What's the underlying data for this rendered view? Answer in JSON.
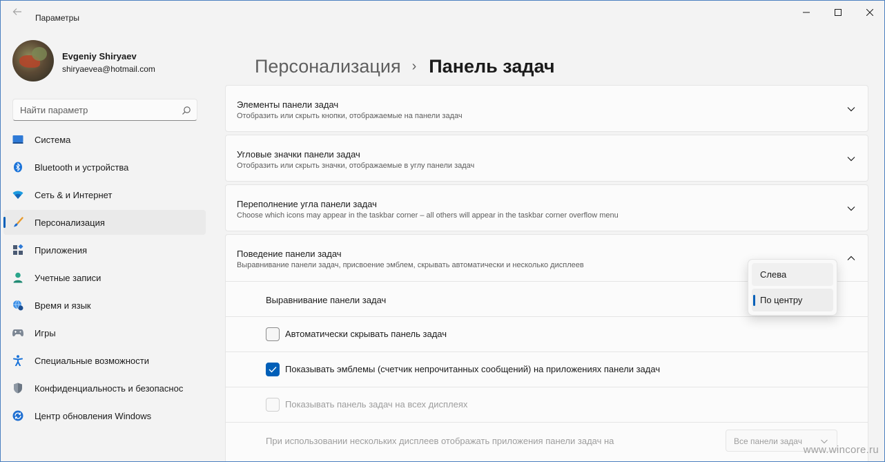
{
  "window": {
    "title": "Параметры"
  },
  "user": {
    "name": "Evgeniy Shiryaev",
    "email": "shiryaevea@hotmail.com"
  },
  "search": {
    "placeholder": "Найти параметр"
  },
  "nav": {
    "items": [
      {
        "label": "Система",
        "icon": "system-icon"
      },
      {
        "label": "Bluetooth и устройства",
        "icon": "bluetooth-icon"
      },
      {
        "label": "Сеть & и Интернет",
        "icon": "wifi-icon"
      },
      {
        "label": "Персонализация",
        "icon": "brush-icon",
        "active": true
      },
      {
        "label": "Приложения",
        "icon": "apps-icon"
      },
      {
        "label": "Учетные записи",
        "icon": "person-icon"
      },
      {
        "label": "Время и язык",
        "icon": "globe-clock-icon"
      },
      {
        "label": "Игры",
        "icon": "gamepad-icon"
      },
      {
        "label": "Специальные возможности",
        "icon": "accessibility-icon"
      },
      {
        "label": "Конфиденциальность и безопаснос",
        "icon": "shield-icon"
      },
      {
        "label": "Центр обновления Windows",
        "icon": "update-icon"
      }
    ]
  },
  "header": {
    "parent": "Персонализация",
    "separator": "›",
    "current": "Панель задач"
  },
  "sections": [
    {
      "title": "Элементы панели задач",
      "desc": "Отобразить или скрыть кнопки, отображаемые на панели задач",
      "expanded": false
    },
    {
      "title": "Угловые значки панели задач",
      "desc": "Отобразить или скрыть значки, отображаемые в углу панели задач",
      "expanded": false
    },
    {
      "title": "Переполнение угла панели задач",
      "desc": "Choose which icons may appear in the taskbar corner – all others will appear in the taskbar corner overflow menu",
      "expanded": false
    },
    {
      "title": "Поведение панели задач",
      "desc": "Выравнивание панели задач, присвоение эмблем, скрывать автоматически и несколько дисплеев",
      "expanded": true
    }
  ],
  "behavior": {
    "alignment_label": "Выравнивание панели задач",
    "alignment_options": [
      "Слева",
      "По центру"
    ],
    "alignment_selected": "По центру",
    "auto_hide": {
      "label": "Автоматически скрывать панель задач",
      "checked": false
    },
    "badges": {
      "label": "Показывать эмблемы (счетчик непрочитанных сообщений) на приложениях панели задач",
      "checked": true
    },
    "all_displays": {
      "label": "Показывать панель задач на всех дисплеях",
      "checked": false,
      "disabled": true
    },
    "multi_display": {
      "label": "При использовании нескольких дисплеев отображать приложения панели задач на",
      "value": "Все панели задач",
      "disabled": true
    }
  },
  "watermark": "www.wincore.ru",
  "colors": {
    "accent": "#005fb8",
    "background": "#f3f3f3",
    "card": "#fbfbfb"
  }
}
